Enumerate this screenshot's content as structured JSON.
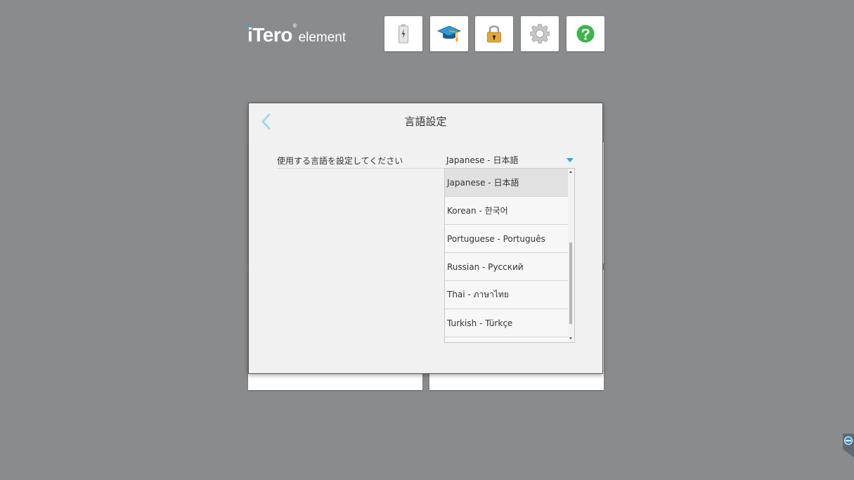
{
  "logo": {
    "brand": "iTero",
    "registered": "®",
    "sub": "element"
  },
  "toolbar": {
    "buttons": [
      {
        "icon": "battery-icon"
      },
      {
        "icon": "graduation-cap-icon"
      },
      {
        "icon": "lock-icon"
      },
      {
        "icon": "gear-icon"
      },
      {
        "icon": "help-icon"
      }
    ]
  },
  "modal": {
    "title": "言語設定",
    "setting_label": "使用する言語を設定してください",
    "selected_value": "Japanese - 日本語"
  },
  "dropdown": {
    "options": [
      {
        "label": "Japanese - 日本語",
        "selected": true
      },
      {
        "label": "Korean - 한국어",
        "selected": false
      },
      {
        "label": "Portuguese - Português",
        "selected": false
      },
      {
        "label": "Russian - Русский",
        "selected": false
      },
      {
        "label": "Thai - ภาษาไทย",
        "selected": false
      },
      {
        "label": "Turkish - Türkçe",
        "selected": false
      }
    ]
  },
  "colors": {
    "background": "#898b8d",
    "accent": "#29abe2",
    "help_green": "#3cb54a",
    "lock_gold": "#e2a73c"
  }
}
